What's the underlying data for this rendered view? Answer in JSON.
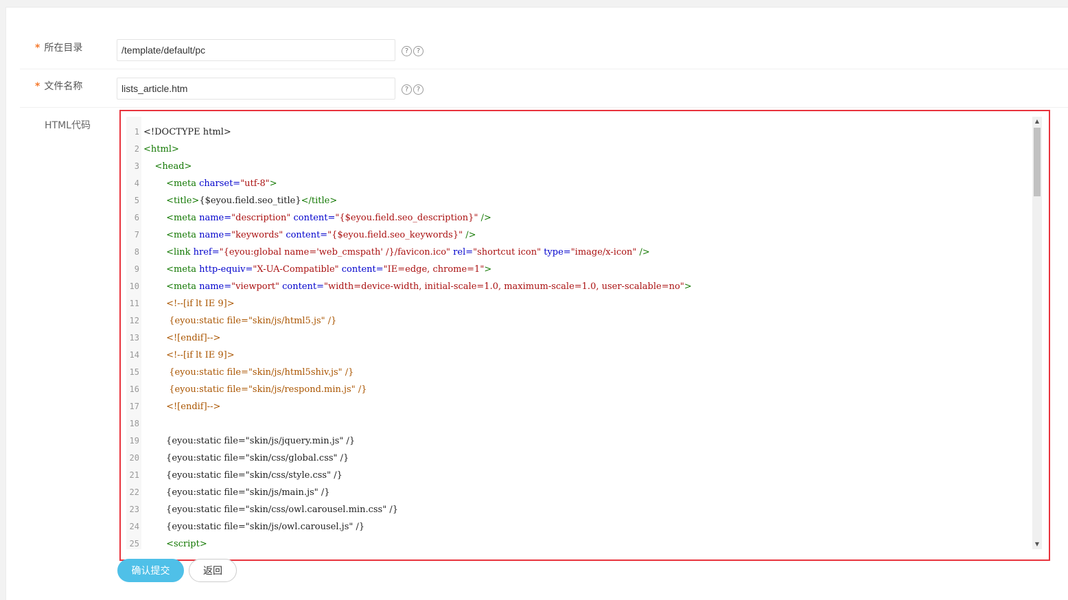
{
  "form": {
    "dir_label": "所在目录",
    "dir_value": "/template/default/pc",
    "file_label": "文件名称",
    "file_value": "lists_article.htm",
    "required_mark": "*",
    "help_glyph": "?",
    "code_label": "HTML代码"
  },
  "buttons": {
    "submit_label": "确认提交",
    "back_label": "返回"
  },
  "code_lines": [
    [
      {
        "c": "plain",
        "t": "<!DOCTYPE html>"
      }
    ],
    [
      {
        "c": "tag",
        "t": "<html>"
      }
    ],
    [
      {
        "c": "plain",
        "t": "    "
      },
      {
        "c": "tag",
        "t": "<head>"
      }
    ],
    [
      {
        "c": "plain",
        "t": "        "
      },
      {
        "c": "tag",
        "t": "<meta "
      },
      {
        "c": "attr",
        "t": "charset="
      },
      {
        "c": "str",
        "t": "\"utf-8\""
      },
      {
        "c": "tag",
        "t": ">"
      }
    ],
    [
      {
        "c": "plain",
        "t": "        "
      },
      {
        "c": "tag",
        "t": "<title>"
      },
      {
        "c": "plain",
        "t": "{$eyou.field.seo_title}"
      },
      {
        "c": "tag",
        "t": "</title>"
      }
    ],
    [
      {
        "c": "plain",
        "t": "        "
      },
      {
        "c": "tag",
        "t": "<meta "
      },
      {
        "c": "attr",
        "t": "name="
      },
      {
        "c": "str",
        "t": "\"description\" "
      },
      {
        "c": "attr",
        "t": "content="
      },
      {
        "c": "str",
        "t": "\"{$eyou.field.seo_description}\" "
      },
      {
        "c": "tag",
        "t": "/>"
      }
    ],
    [
      {
        "c": "plain",
        "t": "        "
      },
      {
        "c": "tag",
        "t": "<meta "
      },
      {
        "c": "attr",
        "t": "name="
      },
      {
        "c": "str",
        "t": "\"keywords\" "
      },
      {
        "c": "attr",
        "t": "content="
      },
      {
        "c": "str",
        "t": "\"{$eyou.field.seo_keywords}\" "
      },
      {
        "c": "tag",
        "t": "/>"
      }
    ],
    [
      {
        "c": "plain",
        "t": "        "
      },
      {
        "c": "tag",
        "t": "<link "
      },
      {
        "c": "attr",
        "t": "href="
      },
      {
        "c": "str",
        "t": "\"{eyou:global name='web_cmspath' /}/favicon.ico\" "
      },
      {
        "c": "attr",
        "t": "rel="
      },
      {
        "c": "str",
        "t": "\"shortcut icon\" "
      },
      {
        "c": "attr",
        "t": "type="
      },
      {
        "c": "str",
        "t": "\"image/x-icon\" "
      },
      {
        "c": "tag",
        "t": "/>"
      }
    ],
    [
      {
        "c": "plain",
        "t": "        "
      },
      {
        "c": "tag",
        "t": "<meta "
      },
      {
        "c": "attr",
        "t": "http-equiv="
      },
      {
        "c": "str",
        "t": "\"X-UA-Compatible\" "
      },
      {
        "c": "attr",
        "t": "content="
      },
      {
        "c": "str",
        "t": "\"IE=edge, chrome=1\""
      },
      {
        "c": "tag",
        "t": ">"
      }
    ],
    [
      {
        "c": "plain",
        "t": "        "
      },
      {
        "c": "tag",
        "t": "<meta "
      },
      {
        "c": "attr",
        "t": "name="
      },
      {
        "c": "str",
        "t": "\"viewport\" "
      },
      {
        "c": "attr",
        "t": "content="
      },
      {
        "c": "str",
        "t": "\"width=device-width, initial-scale=1.0, maximum-scale=1.0, user-scalable=no\""
      },
      {
        "c": "tag",
        "t": ">"
      }
    ],
    [
      {
        "c": "plain",
        "t": "        "
      },
      {
        "c": "com",
        "t": "<!--[if lt IE 9]>"
      }
    ],
    [
      {
        "c": "plain",
        "t": "         "
      },
      {
        "c": "com",
        "t": "{eyou:static file=\"skin/js/html5.js\" /}"
      }
    ],
    [
      {
        "c": "plain",
        "t": "        "
      },
      {
        "c": "com",
        "t": "<![endif]-->"
      }
    ],
    [
      {
        "c": "plain",
        "t": "        "
      },
      {
        "c": "com",
        "t": "<!--[if lt IE 9]>"
      }
    ],
    [
      {
        "c": "plain",
        "t": "         "
      },
      {
        "c": "com",
        "t": "{eyou:static file=\"skin/js/html5shiv.js\" /}"
      }
    ],
    [
      {
        "c": "plain",
        "t": "         "
      },
      {
        "c": "com",
        "t": "{eyou:static file=\"skin/js/respond.min.js\" /}"
      }
    ],
    [
      {
        "c": "plain",
        "t": "        "
      },
      {
        "c": "com",
        "t": "<![endif]-->"
      }
    ],
    [
      {
        "c": "plain",
        "t": ""
      }
    ],
    [
      {
        "c": "plain",
        "t": "        {eyou:static file=\"skin/js/jquery.min.js\" /}"
      }
    ],
    [
      {
        "c": "plain",
        "t": "        {eyou:static file=\"skin/css/global.css\" /}"
      }
    ],
    [
      {
        "c": "plain",
        "t": "        {eyou:static file=\"skin/css/style.css\" /}"
      }
    ],
    [
      {
        "c": "plain",
        "t": "        {eyou:static file=\"skin/js/main.js\" /}"
      }
    ],
    [
      {
        "c": "plain",
        "t": "        {eyou:static file=\"skin/css/owl.carousel.min.css\" /}"
      }
    ],
    [
      {
        "c": "plain",
        "t": "        {eyou:static file=\"skin/js/owl.carousel.js\" /}"
      }
    ],
    [
      {
        "c": "plain",
        "t": "        "
      },
      {
        "c": "tag",
        "t": "<script>"
      }
    ]
  ]
}
